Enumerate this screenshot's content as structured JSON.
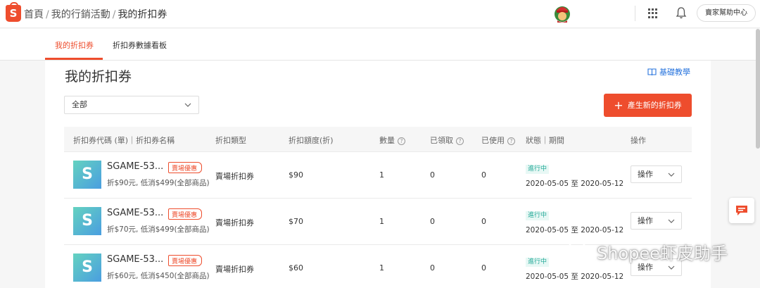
{
  "header": {
    "breadcrumb": [
      "首頁",
      "我的行銷活動",
      "我的折扣券"
    ],
    "help_label": "賣家幫助中心",
    "logo_letter": "S"
  },
  "tabs": [
    {
      "label": "我的折扣券",
      "active": true
    },
    {
      "label": "折扣券數據看板",
      "active": false
    }
  ],
  "page": {
    "title": "我的折扣券",
    "tutorial_label": "基礎教學",
    "filter_value": "全部",
    "create_label": "產生新的折扣券"
  },
  "table": {
    "headers": [
      "折扣券代碼 (單)｜折扣券名稱",
      "折扣類型",
      "折扣額度(折)",
      "數量",
      "已領取",
      "已使用",
      "狀態｜期間",
      "操作"
    ],
    "help_mark": "?",
    "rows": [
      {
        "code": "SGAME-53...",
        "tag": "賣場優惠",
        "desc": "折$90元, 低消$499(全部商品)",
        "type": "賣場折扣券",
        "amount": "$90",
        "qty": "1",
        "claimed": "0",
        "used": "0",
        "status": "進行中",
        "period": "2020-05-05 至 2020-05-12",
        "op": "操作"
      },
      {
        "code": "SGAME-53...",
        "tag": "賣場優惠",
        "desc": "折$70元, 低消$499(全部商品)",
        "type": "賣場折扣券",
        "amount": "$70",
        "qty": "1",
        "claimed": "0",
        "used": "0",
        "status": "進行中",
        "period": "2020-05-05 至 2020-05-12",
        "op": "操作"
      },
      {
        "code": "SGAME-53...",
        "tag": "賣場優惠",
        "desc": "折$60元, 低消$450(全部商品)",
        "type": "賣場折扣券",
        "amount": "$60",
        "qty": "1",
        "claimed": "0",
        "used": "0",
        "status": "進行中",
        "period": "2020-05-05 至 2020-05-12",
        "op": "操作"
      }
    ],
    "thumb_symbol": "S"
  },
  "watermark": "Shopee虾皮助手",
  "colors": {
    "brand": "#ee4d2d",
    "link": "#2673dd",
    "status": "#26aa99"
  }
}
